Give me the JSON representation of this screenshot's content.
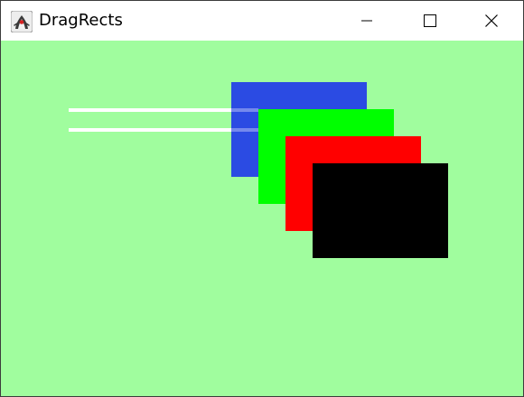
{
  "window": {
    "title": "DragRects",
    "icon": "java-duke-icon",
    "controls": [
      "minimize-icon",
      "maximize-icon",
      "close-icon"
    ]
  },
  "colors": {
    "canvas_bg": "#a0fd9e",
    "line": "#ffffff",
    "rect_blue": "#2b4be3",
    "rect_green": "#00ff00",
    "rect_red": "#ff0000",
    "rect_black": "#000000"
  }
}
